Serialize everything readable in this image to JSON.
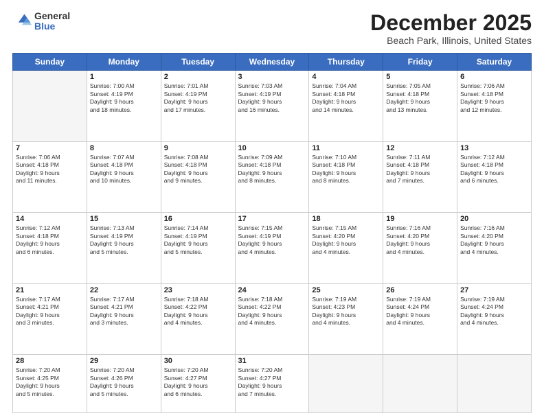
{
  "header": {
    "logo_general": "General",
    "logo_blue": "Blue",
    "title": "December 2025",
    "location": "Beach Park, Illinois, United States"
  },
  "days_of_week": [
    "Sunday",
    "Monday",
    "Tuesday",
    "Wednesday",
    "Thursday",
    "Friday",
    "Saturday"
  ],
  "weeks": [
    [
      {
        "day": null,
        "info": null
      },
      {
        "day": "1",
        "info": "Sunrise: 7:00 AM\nSunset: 4:19 PM\nDaylight: 9 hours\nand 18 minutes."
      },
      {
        "day": "2",
        "info": "Sunrise: 7:01 AM\nSunset: 4:19 PM\nDaylight: 9 hours\nand 17 minutes."
      },
      {
        "day": "3",
        "info": "Sunrise: 7:03 AM\nSunset: 4:19 PM\nDaylight: 9 hours\nand 16 minutes."
      },
      {
        "day": "4",
        "info": "Sunrise: 7:04 AM\nSunset: 4:18 PM\nDaylight: 9 hours\nand 14 minutes."
      },
      {
        "day": "5",
        "info": "Sunrise: 7:05 AM\nSunset: 4:18 PM\nDaylight: 9 hours\nand 13 minutes."
      },
      {
        "day": "6",
        "info": "Sunrise: 7:06 AM\nSunset: 4:18 PM\nDaylight: 9 hours\nand 12 minutes."
      }
    ],
    [
      {
        "day": "7",
        "info": "Sunrise: 7:06 AM\nSunset: 4:18 PM\nDaylight: 9 hours\nand 11 minutes."
      },
      {
        "day": "8",
        "info": "Sunrise: 7:07 AM\nSunset: 4:18 PM\nDaylight: 9 hours\nand 10 minutes."
      },
      {
        "day": "9",
        "info": "Sunrise: 7:08 AM\nSunset: 4:18 PM\nDaylight: 9 hours\nand 9 minutes."
      },
      {
        "day": "10",
        "info": "Sunrise: 7:09 AM\nSunset: 4:18 PM\nDaylight: 9 hours\nand 8 minutes."
      },
      {
        "day": "11",
        "info": "Sunrise: 7:10 AM\nSunset: 4:18 PM\nDaylight: 9 hours\nand 8 minutes."
      },
      {
        "day": "12",
        "info": "Sunrise: 7:11 AM\nSunset: 4:18 PM\nDaylight: 9 hours\nand 7 minutes."
      },
      {
        "day": "13",
        "info": "Sunrise: 7:12 AM\nSunset: 4:18 PM\nDaylight: 9 hours\nand 6 minutes."
      }
    ],
    [
      {
        "day": "14",
        "info": "Sunrise: 7:12 AM\nSunset: 4:18 PM\nDaylight: 9 hours\nand 6 minutes."
      },
      {
        "day": "15",
        "info": "Sunrise: 7:13 AM\nSunset: 4:19 PM\nDaylight: 9 hours\nand 5 minutes."
      },
      {
        "day": "16",
        "info": "Sunrise: 7:14 AM\nSunset: 4:19 PM\nDaylight: 9 hours\nand 5 minutes."
      },
      {
        "day": "17",
        "info": "Sunrise: 7:15 AM\nSunset: 4:19 PM\nDaylight: 9 hours\nand 4 minutes."
      },
      {
        "day": "18",
        "info": "Sunrise: 7:15 AM\nSunset: 4:20 PM\nDaylight: 9 hours\nand 4 minutes."
      },
      {
        "day": "19",
        "info": "Sunrise: 7:16 AM\nSunset: 4:20 PM\nDaylight: 9 hours\nand 4 minutes."
      },
      {
        "day": "20",
        "info": "Sunrise: 7:16 AM\nSunset: 4:20 PM\nDaylight: 9 hours\nand 4 minutes."
      }
    ],
    [
      {
        "day": "21",
        "info": "Sunrise: 7:17 AM\nSunset: 4:21 PM\nDaylight: 9 hours\nand 3 minutes."
      },
      {
        "day": "22",
        "info": "Sunrise: 7:17 AM\nSunset: 4:21 PM\nDaylight: 9 hours\nand 3 minutes."
      },
      {
        "day": "23",
        "info": "Sunrise: 7:18 AM\nSunset: 4:22 PM\nDaylight: 9 hours\nand 4 minutes."
      },
      {
        "day": "24",
        "info": "Sunrise: 7:18 AM\nSunset: 4:22 PM\nDaylight: 9 hours\nand 4 minutes."
      },
      {
        "day": "25",
        "info": "Sunrise: 7:19 AM\nSunset: 4:23 PM\nDaylight: 9 hours\nand 4 minutes."
      },
      {
        "day": "26",
        "info": "Sunrise: 7:19 AM\nSunset: 4:24 PM\nDaylight: 9 hours\nand 4 minutes."
      },
      {
        "day": "27",
        "info": "Sunrise: 7:19 AM\nSunset: 4:24 PM\nDaylight: 9 hours\nand 4 minutes."
      }
    ],
    [
      {
        "day": "28",
        "info": "Sunrise: 7:20 AM\nSunset: 4:25 PM\nDaylight: 9 hours\nand 5 minutes."
      },
      {
        "day": "29",
        "info": "Sunrise: 7:20 AM\nSunset: 4:26 PM\nDaylight: 9 hours\nand 5 minutes."
      },
      {
        "day": "30",
        "info": "Sunrise: 7:20 AM\nSunset: 4:27 PM\nDaylight: 9 hours\nand 6 minutes."
      },
      {
        "day": "31",
        "info": "Sunrise: 7:20 AM\nSunset: 4:27 PM\nDaylight: 9 hours\nand 7 minutes."
      },
      {
        "day": null,
        "info": null
      },
      {
        "day": null,
        "info": null
      },
      {
        "day": null,
        "info": null
      }
    ]
  ]
}
